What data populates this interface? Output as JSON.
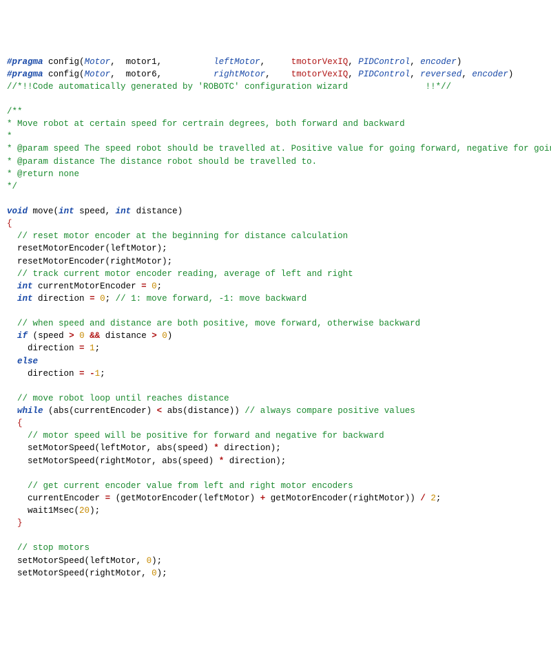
{
  "pragma1": {
    "key": "#pragma",
    "config": "config",
    "p1": "Motor",
    "p2": "motor1",
    "p3": "leftMotor",
    "p4": "tmotorVexIQ",
    "p5": "PIDControl",
    "p6": "encoder"
  },
  "pragma2": {
    "key": "#pragma",
    "config": "config",
    "p1": "Motor",
    "p2": "motor6",
    "p3": "rightMotor",
    "p4": "tmotorVexIQ",
    "p5": "PIDControl",
    "p6": "reversed",
    "p7": "encoder"
  },
  "c": {
    "wizard": "//*!!Code automatically generated by 'ROBOTC' configuration wizard               !!*//",
    "doc1": "/**",
    "doc2": "* Move robot at certain speed for certrain degrees, both forward and backward",
    "doc3": "*",
    "doc4": "* @param speed The speed robot should be travelled at. Positive value for going forward, negative for going backward.",
    "doc5": "* @param distance The distance robot should be travelled to.",
    "doc6": "* @return none",
    "doc7": "*/",
    "reset": "// reset motor encoder at the beginning for distance calculation",
    "track": "// track current motor encoder reading, average of left and right",
    "dir": "// 1: move forward, -1: move backward",
    "when": "// when speed and distance are both positive, move forward, otherwise backward",
    "loop": "// move robot loop until reaches distance",
    "always": "// always compare positive values",
    "mspd": "// motor speed will be positive for forward and negative for backward",
    "getenc": "// get current encoder value from left and right motor encoders",
    "stop": "// stop motors"
  },
  "tok": {
    "void": "void",
    "int": "int",
    "if": "if",
    "else": "else",
    "while": "while"
  },
  "id": {
    "move": "move",
    "speed": "speed",
    "distance": "distance",
    "resetMotorEncoder": "resetMotorEncoder",
    "leftMotor": "leftMotor",
    "rightMotor": "rightMotor",
    "currentMotorEncoder": "currentMotorEncoder",
    "direction": "direction",
    "abs": "abs",
    "currentEncoder": "currentEncoder",
    "setMotorSpeed": "setMotorSpeed",
    "getMotorEncoder": "getMotorEncoder",
    "wait1Msec": "wait1Msec"
  },
  "n": {
    "zero": "0",
    "one": "1",
    "negone": "1",
    "two": "2",
    "twenty": "20"
  }
}
